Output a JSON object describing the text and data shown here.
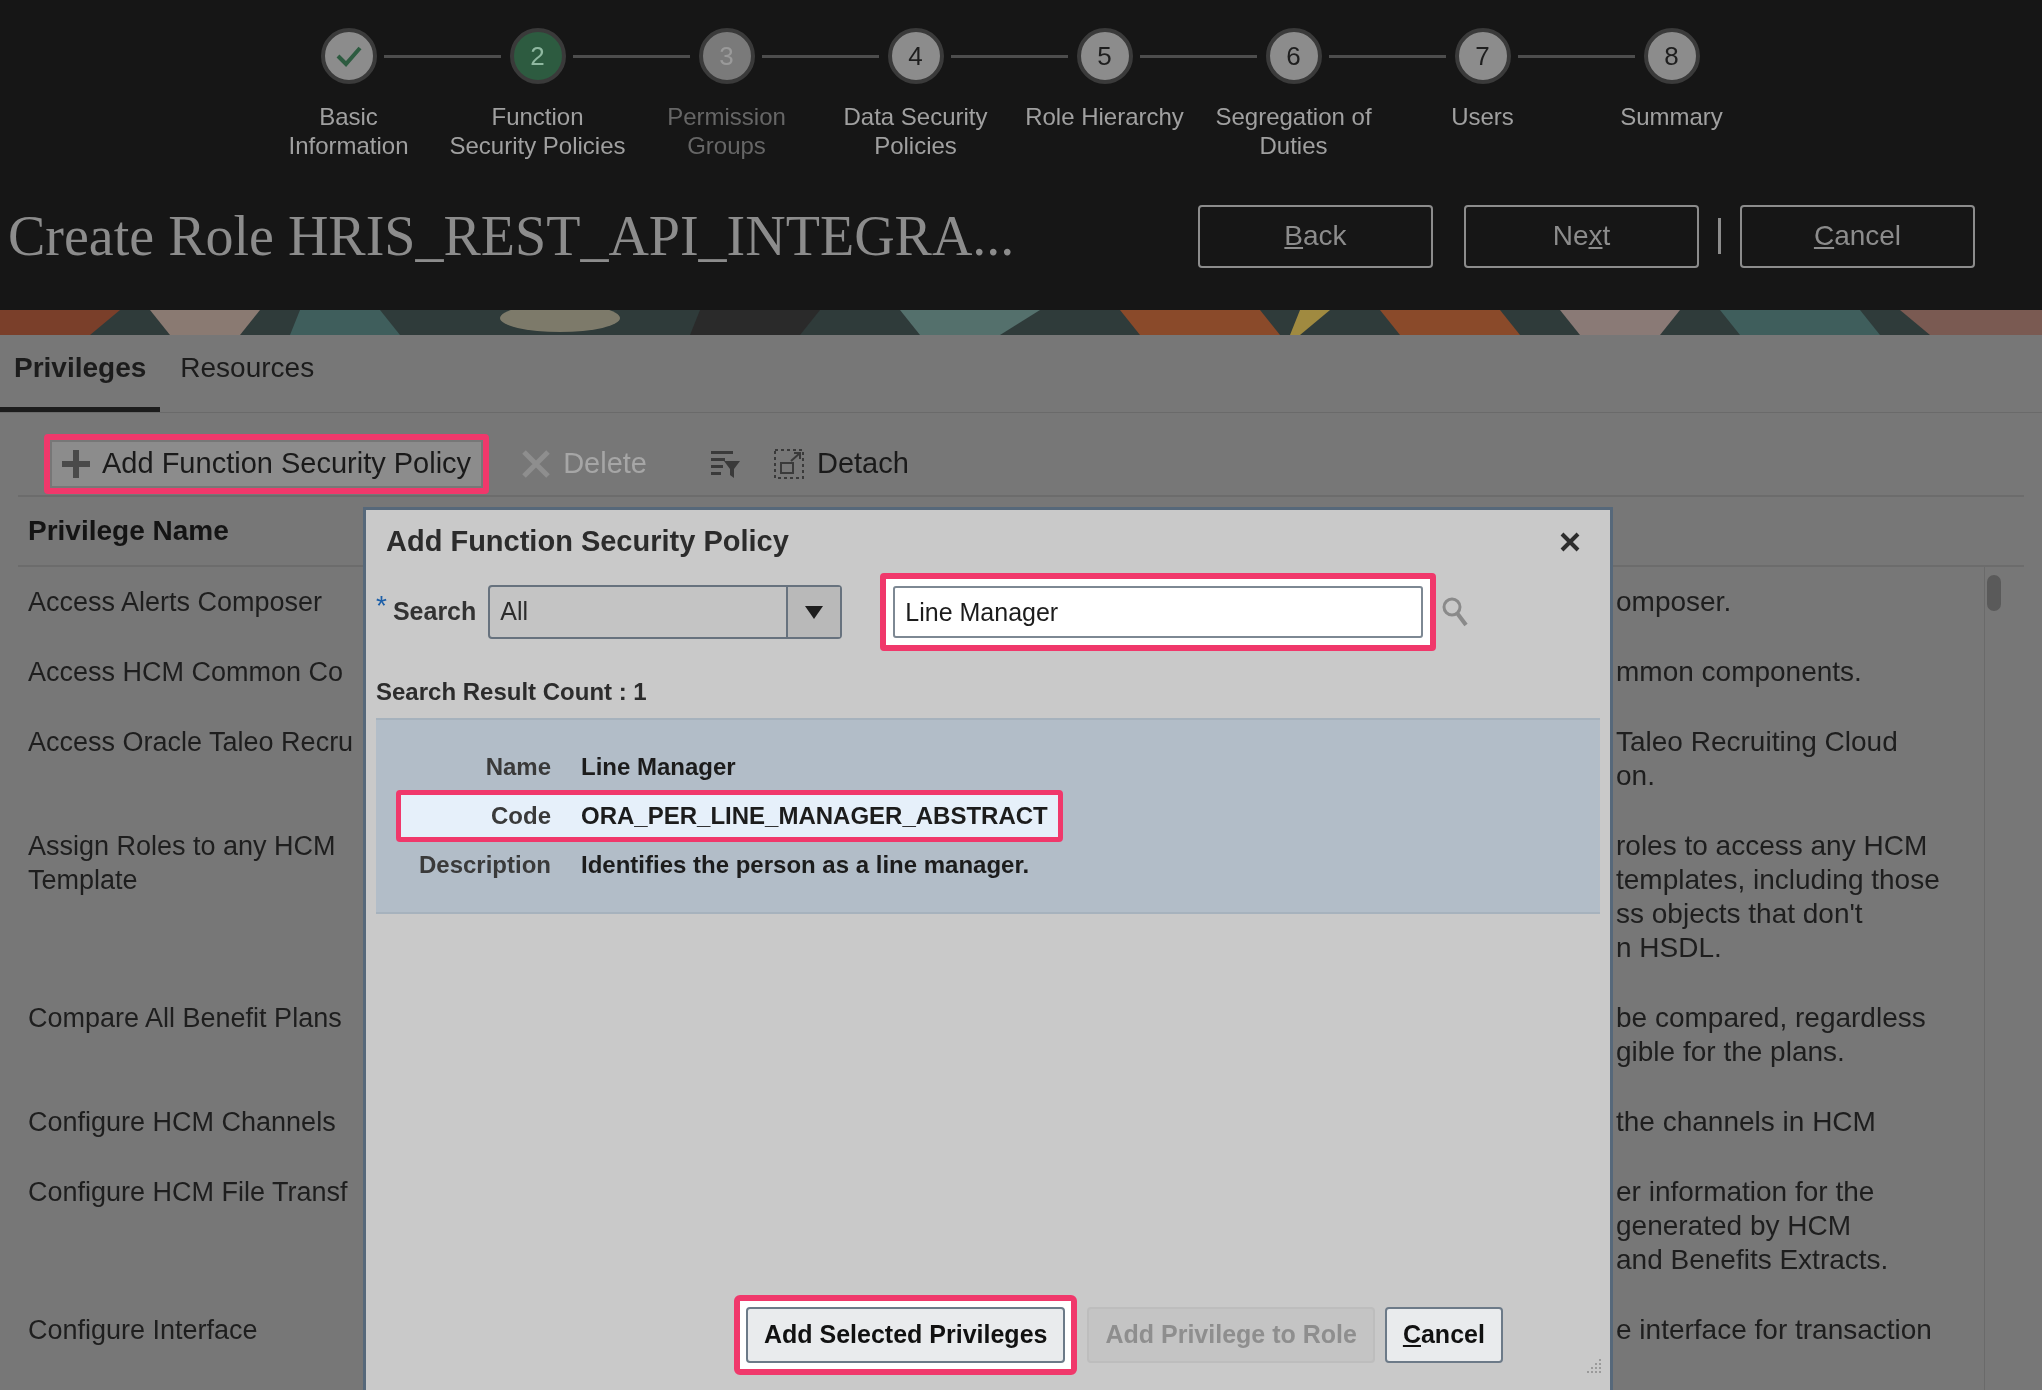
{
  "stepper": [
    {
      "label": "Basic\nInformation",
      "kind": "done"
    },
    {
      "number": "2",
      "label": "Function\nSecurity Policies",
      "kind": "current"
    },
    {
      "number": "3",
      "label": "Permission\nGroups",
      "kind": "disabled"
    },
    {
      "number": "4",
      "label": "Data Security\nPolicies",
      "kind": "pending"
    },
    {
      "number": "5",
      "label": "Role Hierarchy",
      "kind": "pending"
    },
    {
      "number": "6",
      "label": "Segregation of\nDuties",
      "kind": "pending"
    },
    {
      "number": "7",
      "label": "Users",
      "kind": "pending"
    },
    {
      "number": "8",
      "label": "Summary",
      "kind": "pending"
    }
  ],
  "title": "Create Role HRIS_REST_API_INTEGRA...",
  "header_buttons": [
    {
      "key": "B",
      "after": "ack"
    },
    {
      "before": "Ne",
      "key": "x",
      "after": "t"
    },
    {
      "key": "C",
      "after": "ancel"
    }
  ],
  "tabs": [
    {
      "label": "Privileges",
      "selected": true
    },
    {
      "label": "Resources",
      "selected": false
    }
  ],
  "toolbar": [
    {
      "kind": "add",
      "label": "Add Function Security Policy",
      "disabled": false,
      "highlighted": true
    },
    {
      "kind": "delete",
      "label": "Delete",
      "disabled": true,
      "highlighted": false
    },
    {
      "kind": "filter"
    },
    {
      "kind": "detach",
      "label": "Detach",
      "disabled": false,
      "highlighted": false
    }
  ],
  "table": {
    "columns": [
      "Privilege Name"
    ],
    "rows": [
      {
        "name": "Access Alerts Composer",
        "description": "omposer."
      },
      {
        "name": "Access HCM Common Co",
        "description": "mmon components."
      },
      {
        "name": "Access Oracle Taleo Recru",
        "description": "Taleo Recruiting Cloud\non."
      },
      {
        "name": "Assign Roles to any HCM\nTemplate",
        "description": "roles to access any HCM\ntemplates, including those\nss objects that don't\nn HSDL."
      },
      {
        "name": "Compare All Benefit Plans",
        "description": "be compared, regardless\ngible for the plans."
      },
      {
        "name": "Configure HCM Channels",
        "description": "the channels in HCM"
      },
      {
        "name": "Configure HCM File Transf",
        "description": "er information for the\ngenerated by HCM\nand Benefits Extracts."
      },
      {
        "name": "Configure Interface",
        "description": "e interface for transaction"
      }
    ]
  },
  "dialog": {
    "title": "Add Function Security Policy",
    "required_mark": "*",
    "search_label": "Search",
    "select_value": "All",
    "search_value": "Line Manager",
    "search_highlighted": true,
    "result_count": "Search Result Count : 1",
    "result_fields": [
      {
        "label": "Name",
        "value": "Line Manager",
        "highlighted": false
      },
      {
        "label": "Code",
        "value": "ORA_PER_LINE_MANAGER_ABSTRACT",
        "highlighted": true
      },
      {
        "label": "Description",
        "value": "Identifies the person as a line manager.",
        "highlighted": false
      }
    ],
    "buttons": [
      {
        "before": "Add Selected Privileges",
        "disabled": false,
        "highlighted": true
      },
      {
        "before": "Add Privilege to Role",
        "disabled": true,
        "highlighted": false
      },
      {
        "key": "C",
        "after": "ancel",
        "disabled": false,
        "highlighted": false
      }
    ]
  }
}
